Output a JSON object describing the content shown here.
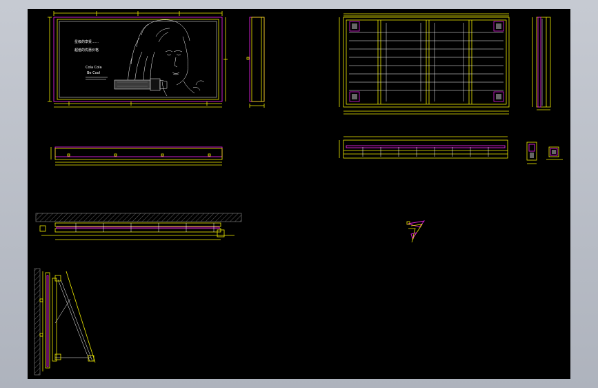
{
  "colors": {
    "background_outer": "#b7bcc6",
    "model_space": "#000000",
    "dimension_lines": "#f4f000",
    "frame_outline": "#e020e0",
    "artwork_lines": "#ffffff"
  },
  "billboard_text": {
    "line1": "星级的享受……",
    "line2": "超值的优惠价格",
    "line3": "Cola Cola",
    "line4": "Be Cool"
  },
  "drawing_views": [
    "front-elevation",
    "side-section",
    "frame-structure-plan",
    "frame-side-section",
    "plan-view",
    "frame-bottom-section",
    "end-section-details",
    "roof-install-section",
    "bracket-node-detail",
    "wall-mounted-support-section"
  ]
}
